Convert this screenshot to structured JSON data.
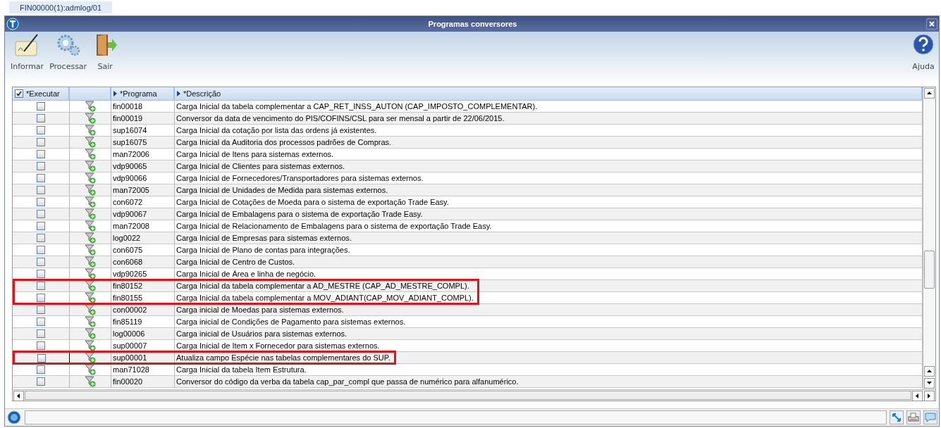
{
  "session_tab": {
    "label": "FIN00000(1):admlog/01",
    "selected": true
  },
  "window": {
    "title": "Programas conversores"
  },
  "toolbar": [
    {
      "kind": "informar",
      "label": "Informar"
    },
    {
      "kind": "processar",
      "label": "Processar"
    },
    {
      "kind": "sair",
      "label": "Sair"
    },
    {
      "kind": "ajuda",
      "label": "Ajuda"
    }
  ],
  "table": {
    "columns": [
      {
        "label": "*Executar",
        "kind": "check",
        "checked": true
      },
      {
        "kind": "icon"
      },
      {
        "label": "*Programa",
        "kind": "sort"
      },
      {
        "label": "*Descrição",
        "kind": "sort"
      }
    ],
    "rows": [
      {
        "programa": "fin00018",
        "descricao": "Carga Inicial da tabela complementar a CAP_RET_INSS_AUTON (CAP_IMPOSTO_COMPLEMENTAR).",
        "checked": false,
        "focused": false,
        "annotated": false
      },
      {
        "programa": "fin00019",
        "descricao": "Conversor da data de vencimento do PIS/COFINS/CSL para ser mensal a partir de 22/06/2015.",
        "checked": false,
        "focused": false,
        "annotated": false
      },
      {
        "programa": "sup16074",
        "descricao": "Carga Inicial da cotação por lista das ordens já existentes.",
        "checked": false,
        "focused": false,
        "annotated": false
      },
      {
        "programa": "sup16075",
        "descricao": "Carga Inicial da Auditoria dos processos padrões de Compras.",
        "checked": false,
        "focused": false,
        "annotated": false
      },
      {
        "programa": "man72006",
        "descricao": "Carga Inicial de Itens para sistemas externos.",
        "checked": false,
        "focused": false,
        "annotated": false
      },
      {
        "programa": "vdp90065",
        "descricao": "Carga Inicial de Clientes para sistemas externos.",
        "checked": false,
        "focused": false,
        "annotated": false
      },
      {
        "programa": "vdp90066",
        "descricao": "Carga Inicial de Fornecedores/Transportadores para sistemas externos.",
        "checked": false,
        "focused": false,
        "annotated": false
      },
      {
        "programa": "man72005",
        "descricao": "Carga Inicial de Unidades de Medida para sistemas externos.",
        "checked": false,
        "focused": false,
        "annotated": false
      },
      {
        "programa": "con6072",
        "descricao": "Carga Inicial de Cotações de Moeda para o sistema de exportação Trade Easy.",
        "checked": false,
        "focused": false,
        "annotated": false
      },
      {
        "programa": "vdp90067",
        "descricao": "Carga Inicial de Embalagens para o sistema de exportação Trade Easy.",
        "checked": false,
        "focused": false,
        "annotated": false
      },
      {
        "programa": "man72008",
        "descricao": "Carga Inicial de Relacionamento de Embalagens para o sistema de exportação Trade Easy.",
        "checked": false,
        "focused": false,
        "annotated": false
      },
      {
        "programa": "log0022",
        "descricao": "Carga Inicial de Empresas para sistemas externos.",
        "checked": false,
        "focused": false,
        "annotated": false
      },
      {
        "programa": "con6075",
        "descricao": "Carga Inicial de Plano de contas para integrações.",
        "checked": false,
        "focused": false,
        "annotated": false
      },
      {
        "programa": "con6068",
        "descricao": "Carga Inicial de Centro de Custos.",
        "checked": false,
        "focused": false,
        "annotated": false
      },
      {
        "programa": "vdp90265",
        "descricao": "Carga Inicial de Área e linha de negócio.",
        "checked": false,
        "focused": false,
        "annotated": false
      },
      {
        "programa": "fin80152",
        "descricao": "Carga Inicial da tabela complementar a AD_MESTRE (CAP_AD_MESTRE_COMPL).",
        "checked": false,
        "focused": false,
        "annotated": true
      },
      {
        "programa": "fin80155",
        "descricao": "Carga Inicial da tabela complementar a MOV_ADIANT(CAP_MOV_ADIANT_COMPL).",
        "checked": false,
        "focused": false,
        "annotated": true
      },
      {
        "programa": "con00002",
        "descricao": "Carga inicial de Moedas para sistemas externos.",
        "checked": false,
        "focused": false,
        "annotated": false
      },
      {
        "programa": "fin85119",
        "descricao": "Carga inicial de Condições de Pagamento para sistemas externos.",
        "checked": false,
        "focused": false,
        "annotated": false
      },
      {
        "programa": "log00006",
        "descricao": "Carga inicial de Usuários para sistemas externos.",
        "checked": false,
        "focused": false,
        "annotated": false
      },
      {
        "programa": "sup00007",
        "descricao": "Carga Inicial de Item x Fornecedor para sistemas externos.",
        "checked": false,
        "focused": false,
        "annotated": false
      },
      {
        "programa": "sup00001",
        "descricao": "Atualiza campo Espécie nas tabelas complementares do SUP.",
        "checked": false,
        "focused": true,
        "annotated": true
      },
      {
        "programa": "man71028",
        "descricao": "Carga Inicial da tabela Item Estrutura.",
        "checked": false,
        "focused": false,
        "annotated": false
      },
      {
        "programa": "fin00020",
        "descricao": "Conversor do código da verba da tabela cap_par_compl que passa de numérico para alfanumérico.",
        "checked": false,
        "focused": false,
        "annotated": false
      }
    ]
  }
}
